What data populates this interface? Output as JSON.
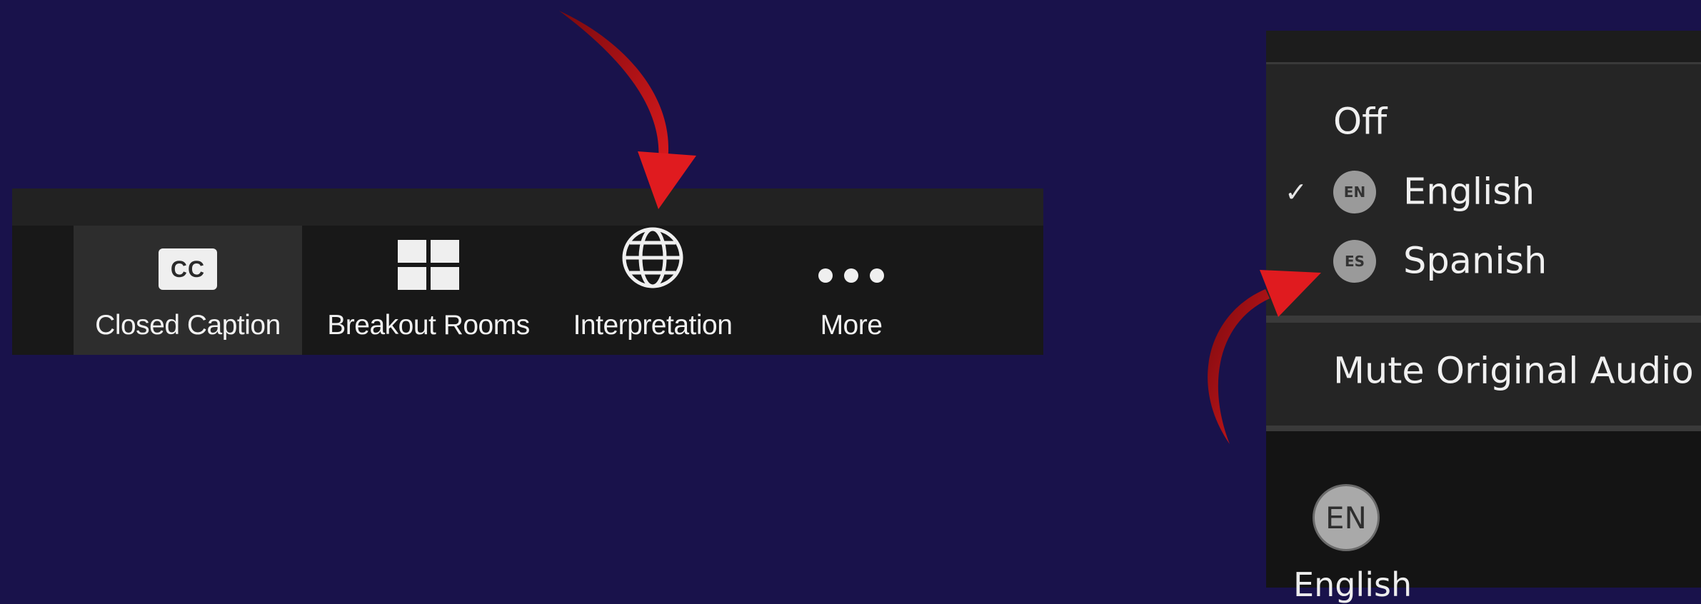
{
  "toolbar": {
    "buttons": [
      {
        "label": "Closed Caption",
        "icon": "closed-caption-icon",
        "icon_text": "CC",
        "active": true
      },
      {
        "label": "Breakout Rooms",
        "icon": "breakout-rooms-grid-icon"
      },
      {
        "label": "Interpretation",
        "icon": "globe-icon"
      },
      {
        "label": "More",
        "icon": "more-dots-icon"
      }
    ]
  },
  "interpretation_menu": {
    "off_label": "Off",
    "languages": [
      {
        "code": "EN",
        "label": "English",
        "checked": true
      },
      {
        "code": "ES",
        "label": "Spanish",
        "checked": false
      }
    ],
    "check_glyph": "✓",
    "mute_label": "Mute Original Audio",
    "current": {
      "code": "EN",
      "label": "English"
    }
  },
  "colors": {
    "background": "#19124b",
    "toolbar": "#181818",
    "panel": "#252525",
    "arrow": "#c8161a"
  }
}
